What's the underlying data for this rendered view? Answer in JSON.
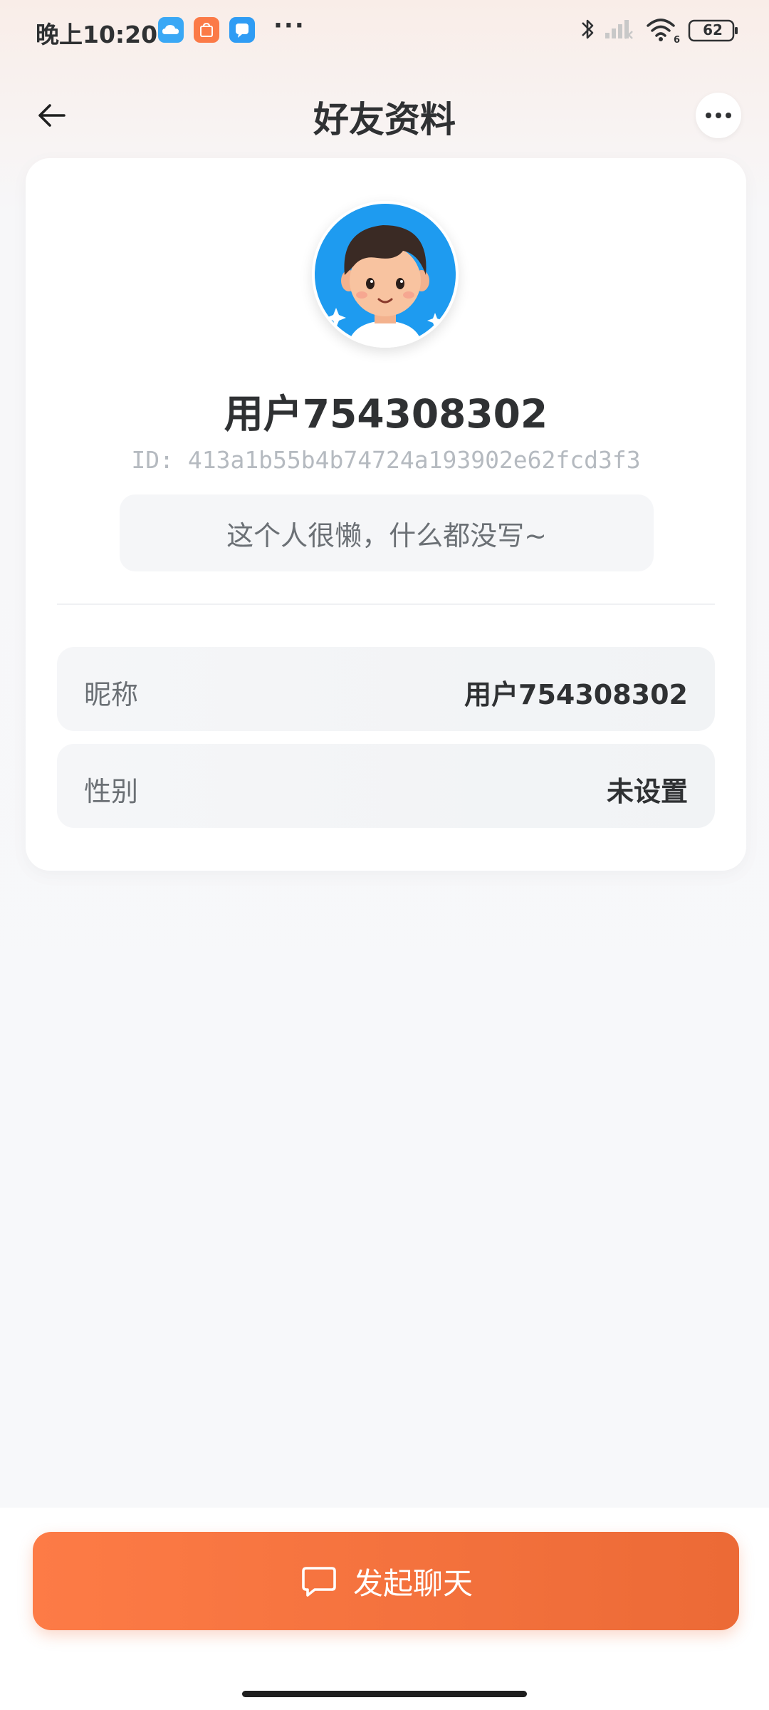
{
  "status_bar": {
    "time": "晚上10:20",
    "battery": "62"
  },
  "nav": {
    "title": "好友资料",
    "back_icon": "arrow-left-icon",
    "more_icon": "more-horizontal-icon"
  },
  "profile": {
    "username": "用户754308302",
    "id_text": "ID: 413a1b55b4b74724a193902e62fcd3f3",
    "bio": "这个人很懒，什么都没写~",
    "fields": [
      {
        "label": "昵称",
        "value": "用户754308302"
      },
      {
        "label": "性别",
        "value": "未设置"
      }
    ]
  },
  "actions": {
    "start_chat_label": "发起聊天",
    "start_chat_icon": "chat-bubble-icon"
  },
  "colors": {
    "accent": "#fd7b46",
    "accent_dark": "#ec6a36",
    "text_primary": "#2f3133",
    "text_secondary": "#6b7075",
    "text_muted": "#b5bac0"
  }
}
